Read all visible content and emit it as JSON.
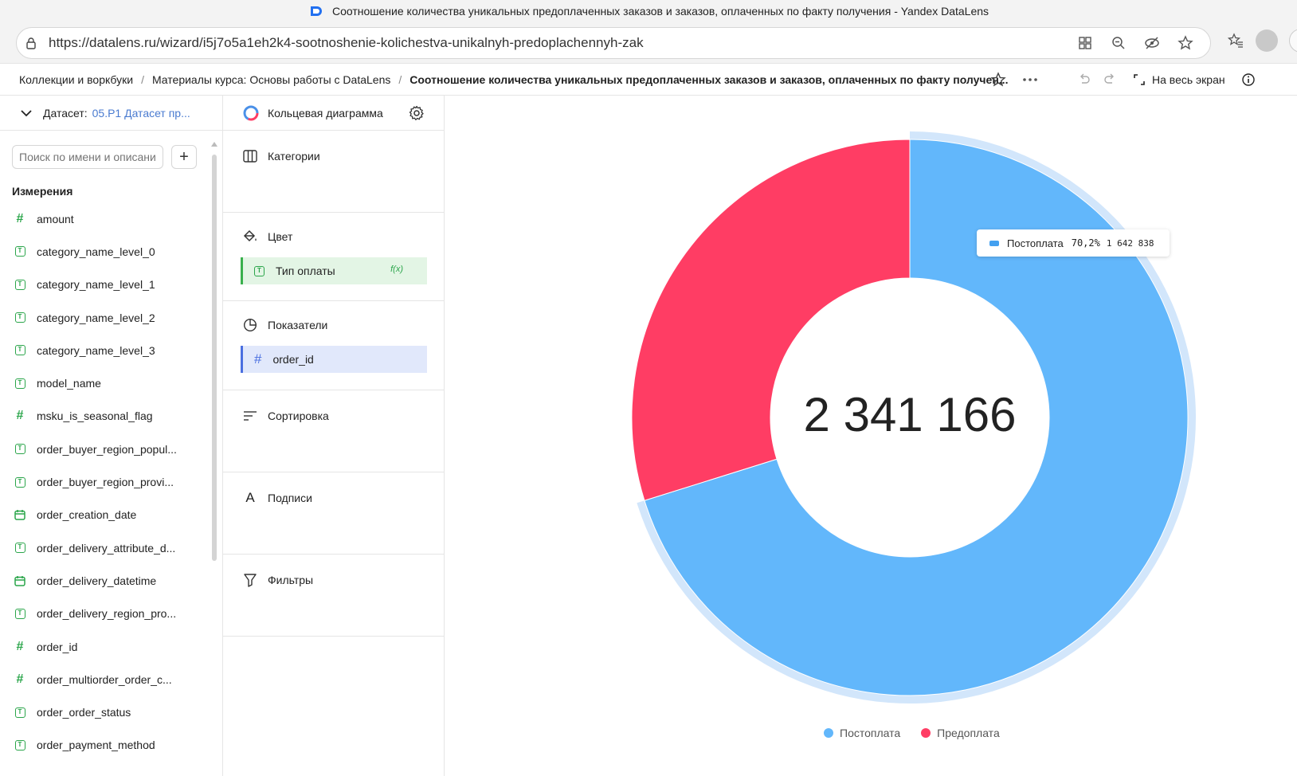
{
  "browser": {
    "title": "Соотношение количества уникальных предоплаченных заказов и заказов, оплаченных по факту получения - Yandex DataLens",
    "url": "https://datalens.ru/wizard/i5j7o5a1eh2k4-sootnoshenie-kolichestva-unikalnyh-predoplachennyh-zak"
  },
  "breadcrumb": {
    "items": [
      "Коллекции и воркбуки",
      "Материалы курса: Основы работы с DataLens"
    ],
    "current": "Соотношение количества уникальных предоплаченных заказов и заказов, оплаченных по факту получен...",
    "fullscreen_label": "На весь экран"
  },
  "dataset": {
    "label": "Датасет:",
    "name": "05.P1 Датасет пр...",
    "search_placeholder": "Поиск по имени и описанию",
    "section_title": "Измерения",
    "fields": [
      {
        "name": "amount",
        "type": "number"
      },
      {
        "name": "category_name_level_0",
        "type": "text"
      },
      {
        "name": "category_name_level_1",
        "type": "text"
      },
      {
        "name": "category_name_level_2",
        "type": "text"
      },
      {
        "name": "category_name_level_3",
        "type": "text"
      },
      {
        "name": "model_name",
        "type": "text"
      },
      {
        "name": "msku_is_seasonal_flag",
        "type": "number"
      },
      {
        "name": "order_buyer_region_popul...",
        "type": "text"
      },
      {
        "name": "order_buyer_region_provi...",
        "type": "text"
      },
      {
        "name": "order_creation_date",
        "type": "date"
      },
      {
        "name": "order_delivery_attribute_d...",
        "type": "text"
      },
      {
        "name": "order_delivery_datetime",
        "type": "date"
      },
      {
        "name": "order_delivery_region_pro...",
        "type": "text"
      },
      {
        "name": "order_id",
        "type": "number"
      },
      {
        "name": "order_multiorder_order_c...",
        "type": "number"
      },
      {
        "name": "order_order_status",
        "type": "text"
      },
      {
        "name": "order_payment_method",
        "type": "text"
      }
    ]
  },
  "visualization": {
    "name": "Кольцевая диаграмма",
    "sections": {
      "categories": "Категории",
      "color": "Цвет",
      "color_field": "Тип оплаты",
      "color_field_badge": "f(x)",
      "measures": "Показатели",
      "measure_field": "order_id",
      "sort": "Сортировка",
      "labels": "Подписи",
      "filters": "Фильтры"
    }
  },
  "tooltip": {
    "series": "Постоплата",
    "percent": "70,2%",
    "value": "1 642 838"
  },
  "chart_data": {
    "type": "pie",
    "total_label": "2 341 166",
    "series": [
      {
        "name": "Постоплата",
        "value": 1642838,
        "color": "#62b7fb"
      },
      {
        "name": "Предоплата",
        "value": 698328,
        "color": "#ff3d64"
      }
    ],
    "legend_position": "bottom",
    "highlighted": "Постоплата"
  }
}
